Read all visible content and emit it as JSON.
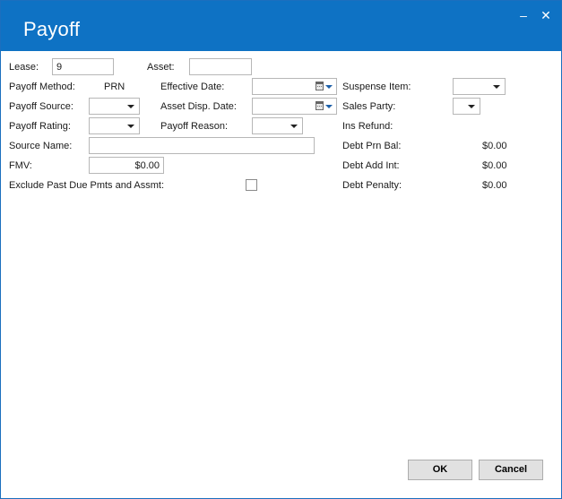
{
  "window": {
    "title": "Payoff",
    "minimize_icon": "minimize-icon",
    "close_icon": "close-icon"
  },
  "form": {
    "lease_label": "Lease:",
    "lease_value": "9",
    "asset_label": "Asset:",
    "asset_value": "",
    "payoff_method_label": "Payoff Method:",
    "payoff_method_value": "PRN",
    "effective_date_label": "Effective Date:",
    "suspense_item_label": "Suspense Item:",
    "payoff_source_label": "Payoff Source:",
    "asset_disp_date_label": "Asset Disp. Date:",
    "sales_party_label": "Sales Party:",
    "payoff_rating_label": "Payoff Rating:",
    "payoff_reason_label": "Payoff Reason:",
    "ins_refund_label": "Ins Refund:",
    "source_name_label": "Source Name:",
    "source_name_value": "",
    "debt_prn_bal_label": "Debt Prn Bal:",
    "debt_prn_bal_value": "$0.00",
    "fmv_label": "FMV:",
    "fmv_value": "$0.00",
    "debt_add_int_label": "Debt Add Int:",
    "debt_add_int_value": "$0.00",
    "exclude_label": "Exclude Past Due Pmts and Assmt:",
    "exclude_checked": false,
    "debt_penalty_label": "Debt Penalty:",
    "debt_penalty_value": "$0.00"
  },
  "buttons": {
    "ok_label": "OK",
    "cancel_label": "Cancel"
  },
  "colors": {
    "titlebar": "#0e72c4",
    "border": "#b7b7b7",
    "button_bg": "#e1e1e1"
  }
}
